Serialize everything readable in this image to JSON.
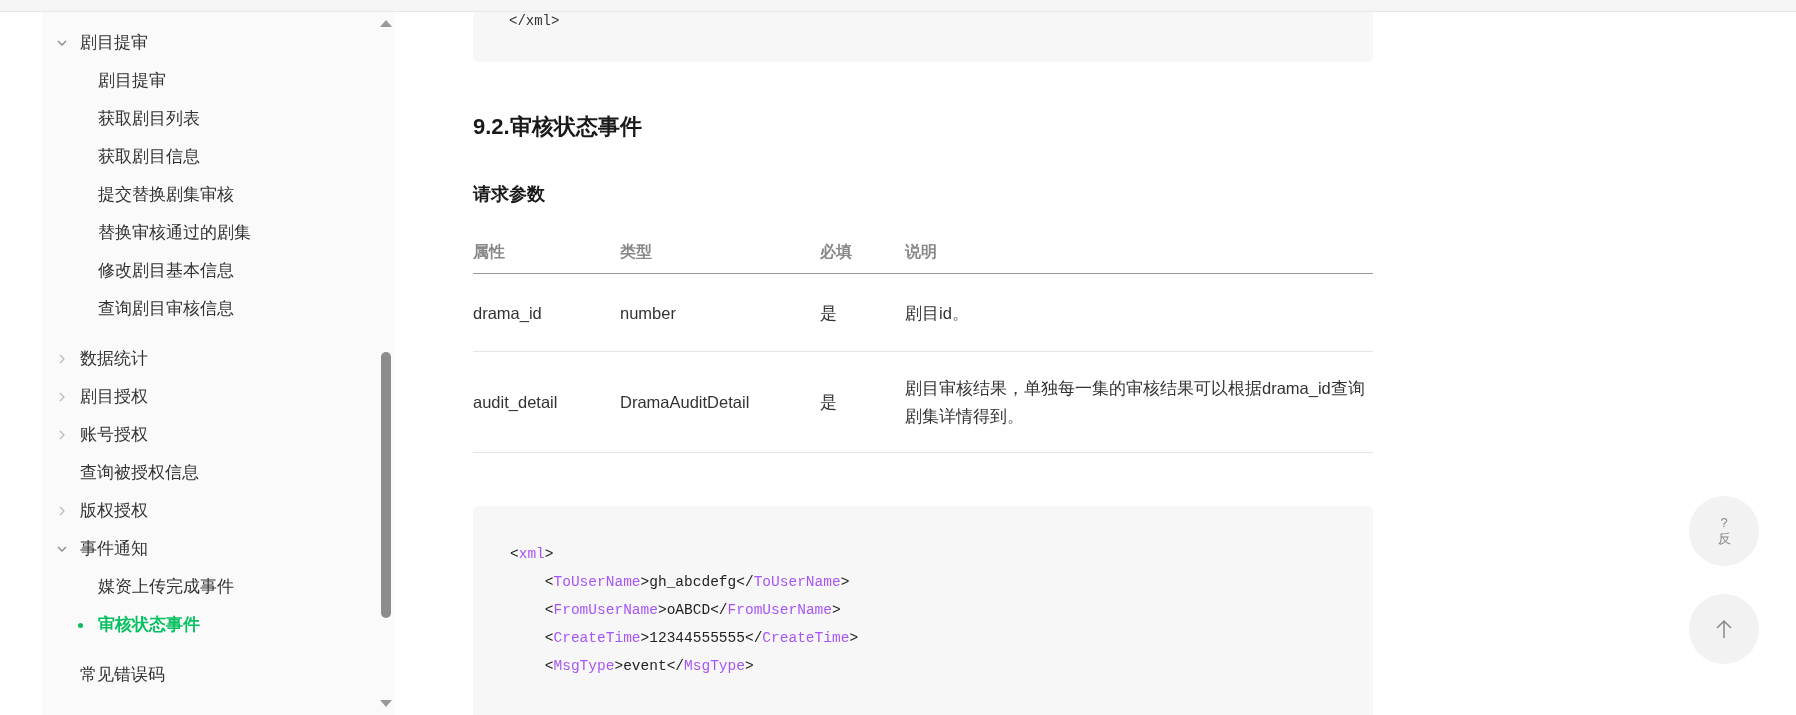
{
  "sidebar": {
    "items": [
      {
        "label": "剧目提审",
        "expanded": true,
        "selected": false,
        "children": [
          {
            "label": "剧目提审",
            "selected": false
          },
          {
            "label": "获取剧目列表",
            "selected": false
          },
          {
            "label": "获取剧目信息",
            "selected": false
          },
          {
            "label": "提交替换剧集审核",
            "selected": false
          },
          {
            "label": "替换审核通过的剧集",
            "selected": false
          },
          {
            "label": "修改剧目基本信息",
            "selected": false
          },
          {
            "label": "查询剧目审核信息",
            "selected": false
          }
        ]
      },
      {
        "label": "数据统计",
        "expanded": false,
        "selected": false
      },
      {
        "label": "剧目授权",
        "expanded": false,
        "selected": false
      },
      {
        "label": "账号授权",
        "expanded": false,
        "selected": false
      },
      {
        "label": "查询被授权信息",
        "selected": false
      },
      {
        "label": "版权授权",
        "expanded": false,
        "selected": false
      },
      {
        "label": "事件通知",
        "expanded": true,
        "selected": false,
        "children": [
          {
            "label": "媒资上传完成事件",
            "selected": false
          },
          {
            "label": "审核状态事件",
            "selected": true
          }
        ]
      },
      {
        "label": "常见错误码",
        "selected": false
      }
    ]
  },
  "content": {
    "prev_code_tail": "</xml>",
    "heading": "9.2.审核状态事件",
    "subheading": "请求参数",
    "table": {
      "columns": [
        "属性",
        "类型",
        "必填",
        "说明"
      ],
      "rows": [
        [
          "drama_id",
          "number",
          "是",
          "剧目id。"
        ],
        [
          "audit_detail",
          "DramaAuditDetail",
          "是",
          "剧目审核结果，单独每一集的审核结果可以根据drama_id查询剧集详情得到。"
        ]
      ]
    },
    "code": [
      "<xml>",
      "    <ToUserName>gh_abcdefg</ToUserName>",
      "    <FromUserName>oABCD</FromUserName>",
      "    <CreateTime>12344555555</CreateTime>",
      "    <MsgType>event</MsgType>"
    ]
  },
  "float_buttons": {
    "feedback_glyph": "?",
    "feedback_label": "反"
  }
}
